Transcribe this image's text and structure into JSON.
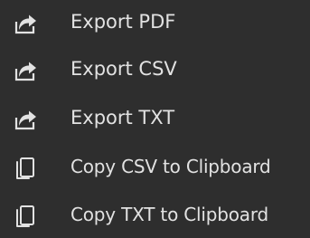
{
  "menu": {
    "items": [
      {
        "label": "Export PDF",
        "icon": "export-icon"
      },
      {
        "label": "Export CSV",
        "icon": "export-icon"
      },
      {
        "label": "Export TXT",
        "icon": "export-icon"
      },
      {
        "label": "Copy CSV to Clipboard",
        "icon": "copy-icon"
      },
      {
        "label": "Copy TXT to Clipboard",
        "icon": "copy-icon"
      }
    ],
    "colors": {
      "background": "#2e2e2e",
      "text": "#e2e2e2"
    }
  }
}
